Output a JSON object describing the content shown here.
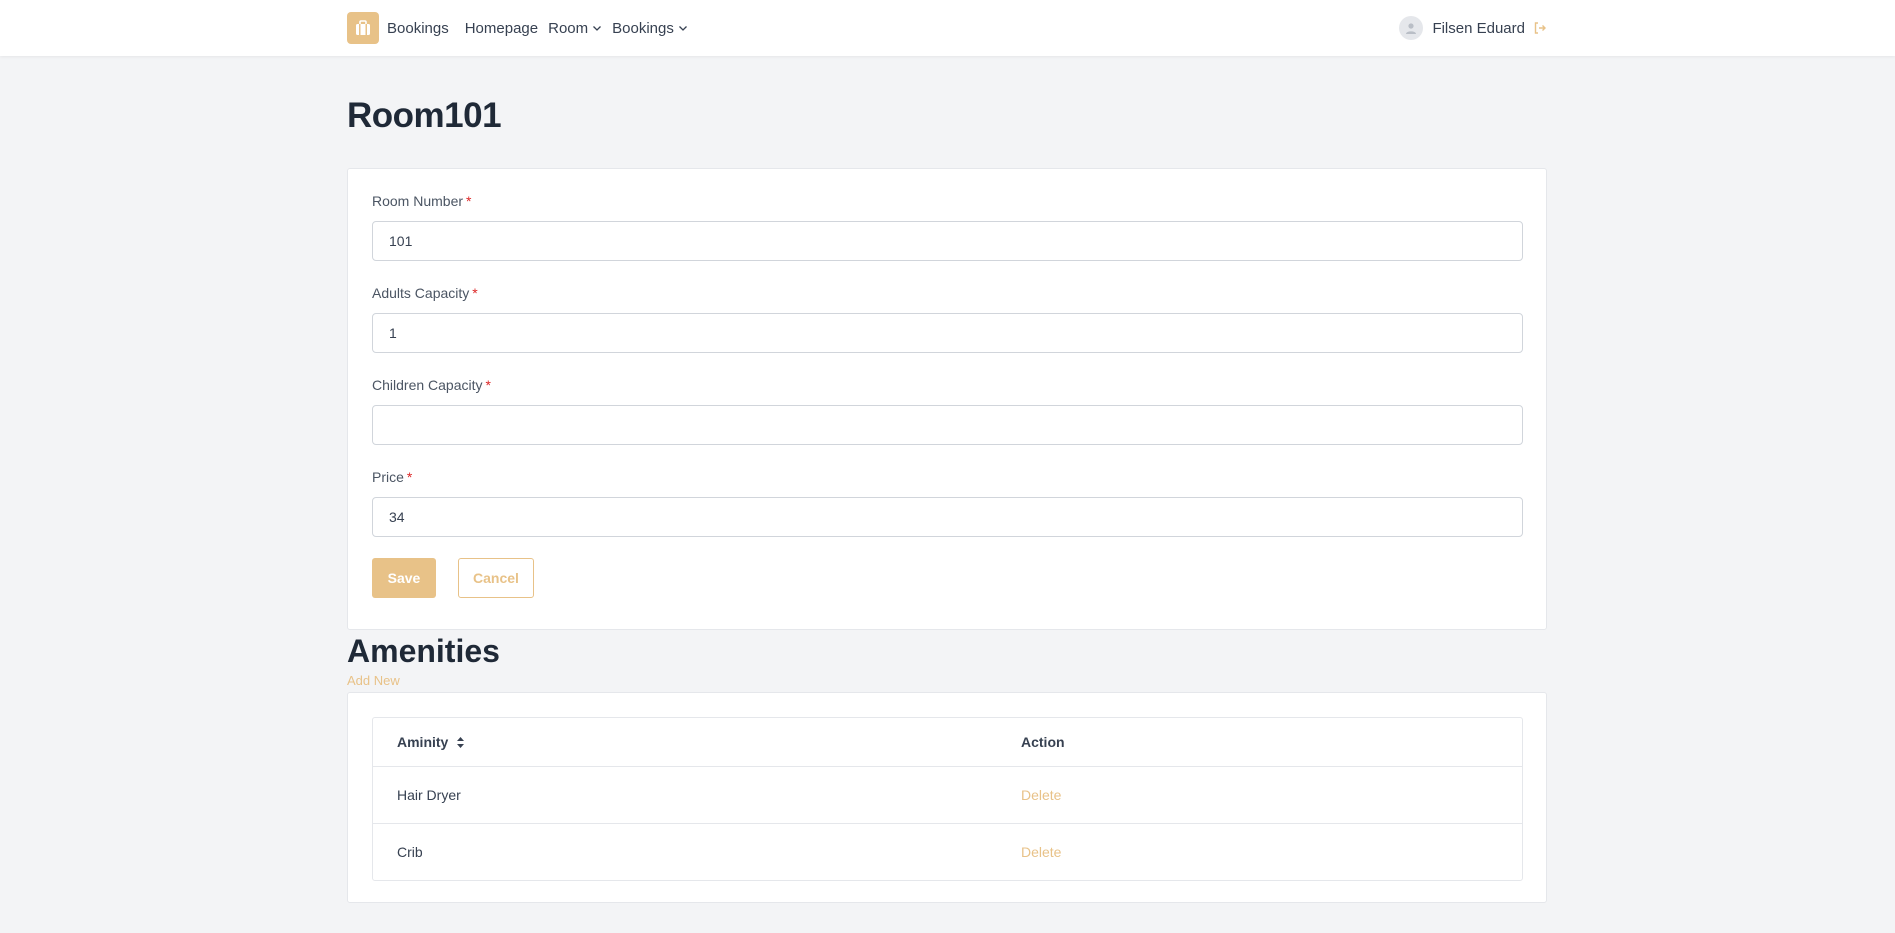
{
  "nav": {
    "brand": "Bookings",
    "links": [
      {
        "label": "Homepage",
        "dropdown": false
      },
      {
        "label": "Room",
        "dropdown": true
      },
      {
        "label": "Bookings",
        "dropdown": true
      }
    ],
    "user": "Filsen Eduard"
  },
  "page": {
    "title": "Room101"
  },
  "form": {
    "fields": [
      {
        "label": "Room Number",
        "required": "*",
        "value": "101"
      },
      {
        "label": "Adults Capacity",
        "required": "*",
        "value": "1"
      },
      {
        "label": "Children Capacity",
        "required": "*",
        "value": ""
      },
      {
        "label": "Price",
        "required": "*",
        "value": "34"
      }
    ],
    "save_label": "Save",
    "cancel_label": "Cancel"
  },
  "amenities": {
    "title": "Amenities",
    "add_new": "Add New",
    "columns": [
      "Aminity",
      "Action"
    ],
    "rows": [
      {
        "name": "Hair Dryer",
        "action": "Delete"
      },
      {
        "name": "Crib",
        "action": "Delete"
      }
    ]
  },
  "colors": {
    "accent": "#e8c288",
    "background": "#f3f4f6",
    "required": "#dc2626"
  },
  "icons": {
    "brand": "briefcase-icon",
    "dropdown": "chevron-down-icon",
    "avatar": "user-avatar-icon",
    "logout": "logout-icon",
    "sort": "sort-icon"
  }
}
